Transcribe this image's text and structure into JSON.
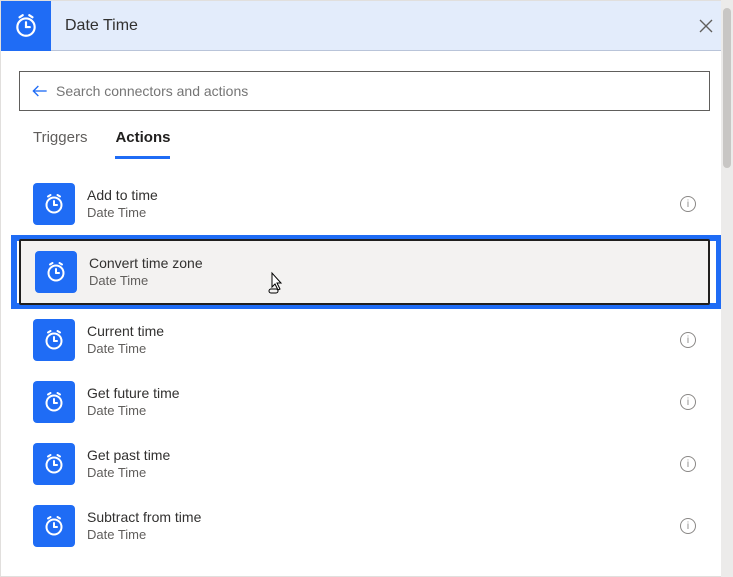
{
  "header": {
    "title": "Date Time"
  },
  "search": {
    "placeholder": "Search connectors and actions"
  },
  "tabs": {
    "triggers": "Triggers",
    "actions": "Actions"
  },
  "actions": [
    {
      "title": "Add to time",
      "subtitle": "Date Time",
      "highlighted": false
    },
    {
      "title": "Convert time zone",
      "subtitle": "Date Time",
      "highlighted": true
    },
    {
      "title": "Current time",
      "subtitle": "Date Time",
      "highlighted": false
    },
    {
      "title": "Get future time",
      "subtitle": "Date Time",
      "highlighted": false
    },
    {
      "title": "Get past time",
      "subtitle": "Date Time",
      "highlighted": false
    },
    {
      "title": "Subtract from time",
      "subtitle": "Date Time",
      "highlighted": false
    }
  ]
}
